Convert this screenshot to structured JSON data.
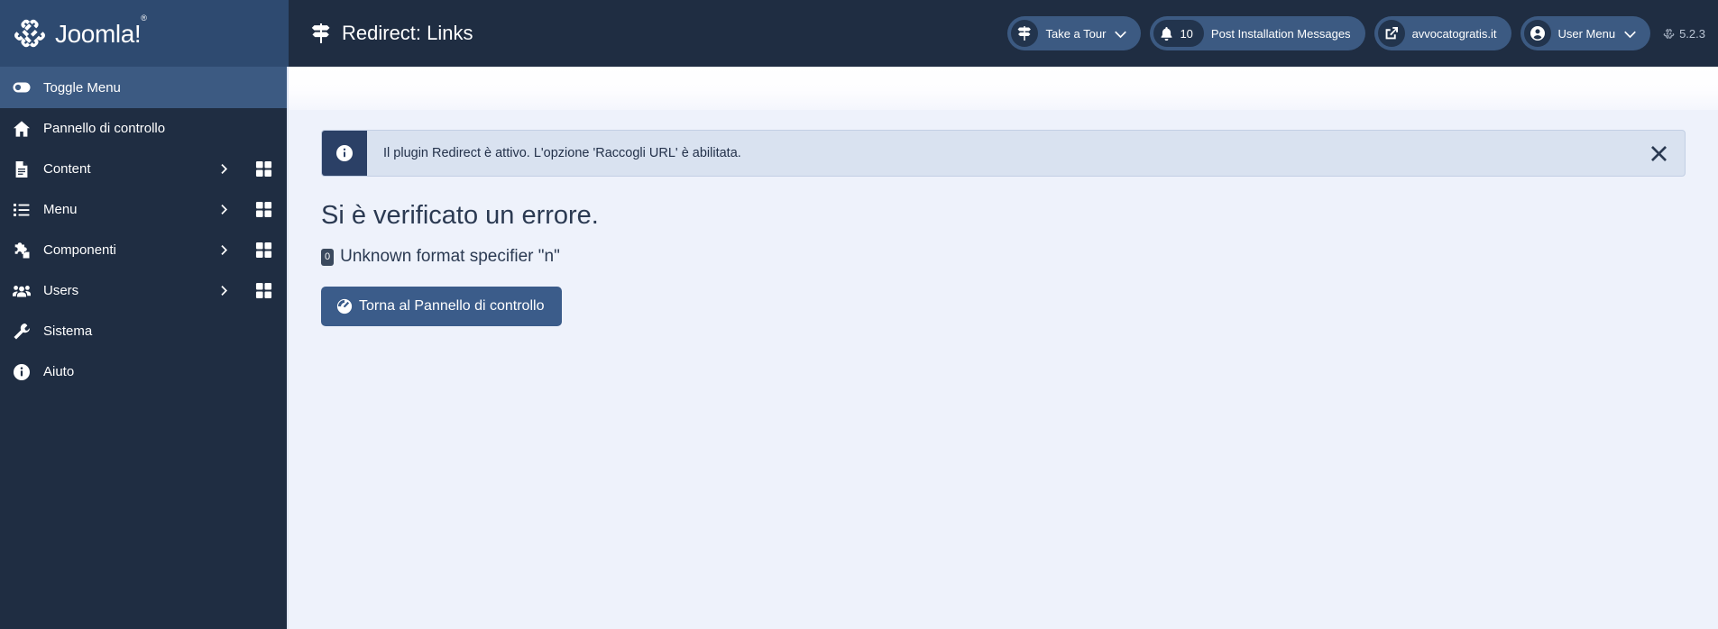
{
  "brand": {
    "name": "Joomla!",
    "trademark": "®",
    "logo_icon": "joomla-logo-icon"
  },
  "header": {
    "page_title": "Redirect: Links",
    "page_title_icon": "signpost-icon",
    "take_a_tour": {
      "label": "Take a Tour",
      "icon": "signpost-icon",
      "caret_icon": "chevron-down-icon"
    },
    "notifications": {
      "count": "10",
      "label": "Post Installation Messages",
      "icon": "bell-icon"
    },
    "site_link": {
      "label": "avvocatogratis.it",
      "icon": "external-link-icon"
    },
    "user_menu": {
      "label": "User Menu",
      "icon": "user-circle-icon",
      "caret_icon": "chevron-down-icon"
    },
    "version": {
      "label": "5.2.3",
      "icon": "joomla-mark-icon"
    }
  },
  "sidebar": {
    "toggle": {
      "label": "Toggle Menu",
      "icon": "toggle-switch-icon"
    },
    "items": [
      {
        "label": "Pannello di controllo",
        "icon": "home-icon",
        "has_chevron": false,
        "has_grid": false
      },
      {
        "label": "Content",
        "icon": "document-icon",
        "has_chevron": true,
        "has_grid": true
      },
      {
        "label": "Menu",
        "icon": "list-icon",
        "has_chevron": true,
        "has_grid": true
      },
      {
        "label": "Componenti",
        "icon": "puzzle-icon",
        "has_chevron": true,
        "has_grid": true
      },
      {
        "label": "Users",
        "icon": "users-icon",
        "has_chevron": true,
        "has_grid": true
      },
      {
        "label": "Sistema",
        "icon": "wrench-icon",
        "has_chevron": false,
        "has_grid": false
      },
      {
        "label": "Aiuto",
        "icon": "info-circle-icon",
        "has_chevron": false,
        "has_grid": false
      }
    ]
  },
  "main": {
    "alert": {
      "icon": "info-circle-icon",
      "message": "Il plugin Redirect è attivo. L'opzione 'Raccogli URL' è abilitata.",
      "close_icon": "close-icon"
    },
    "error": {
      "heading": "Si è verificato un errore.",
      "code": "0",
      "message": "Unknown format specifier \"n\""
    },
    "back_button": {
      "label": "Torna al Pannello di controllo",
      "icon": "dashboard-gauge-icon"
    }
  },
  "colors": {
    "header_bg": "#1f2d42",
    "brand_bg": "#2e4a70",
    "sidebar_bg": "#1f2d42",
    "sidebar_active": "#3c5a82",
    "pill_bg": "#3c5a82",
    "main_bg": "#eef2fb",
    "alert_bg": "#d9e2f0",
    "alert_icon_bg": "#2b4066",
    "primary_button": "#3b5c8a"
  }
}
